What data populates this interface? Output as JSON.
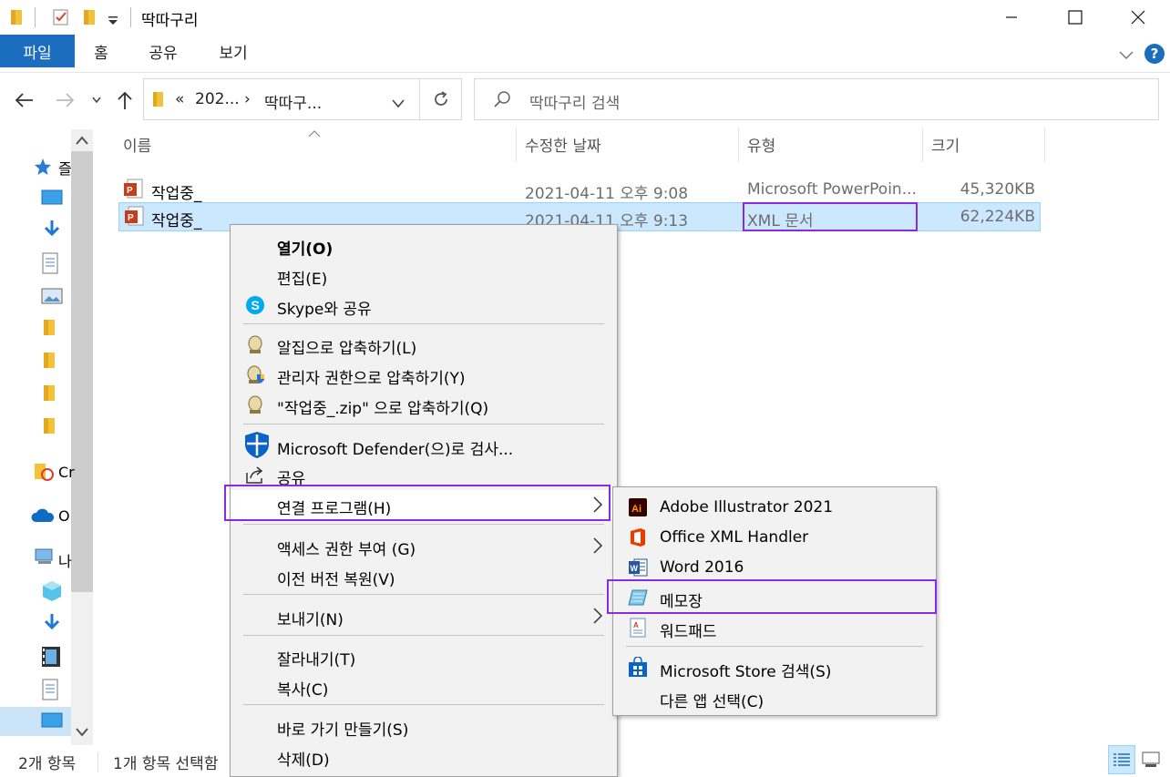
{
  "window": {
    "title": "딱따구리",
    "minimize_icon": "minimize-icon",
    "maximize_icon": "maximize-icon",
    "close_icon": "close-icon"
  },
  "ribbon": {
    "tabs": [
      "파일",
      "홈",
      "공유",
      "보기"
    ],
    "help_label": "?"
  },
  "address": {
    "prefix": "«",
    "segment1": "202...",
    "separator": "›",
    "segment2": "딱따구..."
  },
  "search": {
    "placeholder": "딱따구리 검색"
  },
  "sidebar": {
    "quick_access_label": "즐",
    "creative_cloud_label": "Cr",
    "onedrive_label": "O",
    "this_pc_label": "나"
  },
  "columns": {
    "name": "이름",
    "date": "수정한 날짜",
    "type": "유형",
    "size": "크기"
  },
  "files": [
    {
      "name": "작업중_",
      "date": "2021-04-11 오후 9:08",
      "type": "Microsoft PowerPoin...",
      "size": "45,320KB"
    },
    {
      "name": "작업중_",
      "date": "2021-04-11 오후 9:13",
      "type": "XML 문서",
      "size": "62,224KB"
    }
  ],
  "context_menu": {
    "open": "열기(O)",
    "edit": "편집(E)",
    "skype": "Skype와 공유",
    "alzip": "알집으로 압축하기(L)",
    "alzip_admin": "관리자 권한으로 압축하기(Y)",
    "alzip_named": "\"작업중_.zip\" 으로 압축하기(Q)",
    "defender": "Microsoft Defender(으)로 검사...",
    "share": "공유",
    "open_with": "연결 프로그램(H)",
    "access": "액세스 권한 부여 (G)",
    "restore": "이전 버전 복원(V)",
    "send_to": "보내기(N)",
    "cut": "잘라내기(T)",
    "copy": "복사(C)",
    "shortcut": "바로 가기 만들기(S)",
    "delete": "삭제(D)"
  },
  "open_with_menu": {
    "illustrator": "Adobe Illustrator 2021",
    "office_xml": "Office XML Handler",
    "word": "Word 2016",
    "notepad": "메모장",
    "wordpad": "워드패드",
    "store": "Microsoft Store 검색(S)",
    "other": "다른 앱 선택(C)"
  },
  "status": {
    "count": "2개 항목",
    "selected": "1개 항목 선택함"
  },
  "colors": {
    "accent": "#1a6ebd",
    "highlight": "#8a2be2",
    "selection": "#cce8ff"
  }
}
